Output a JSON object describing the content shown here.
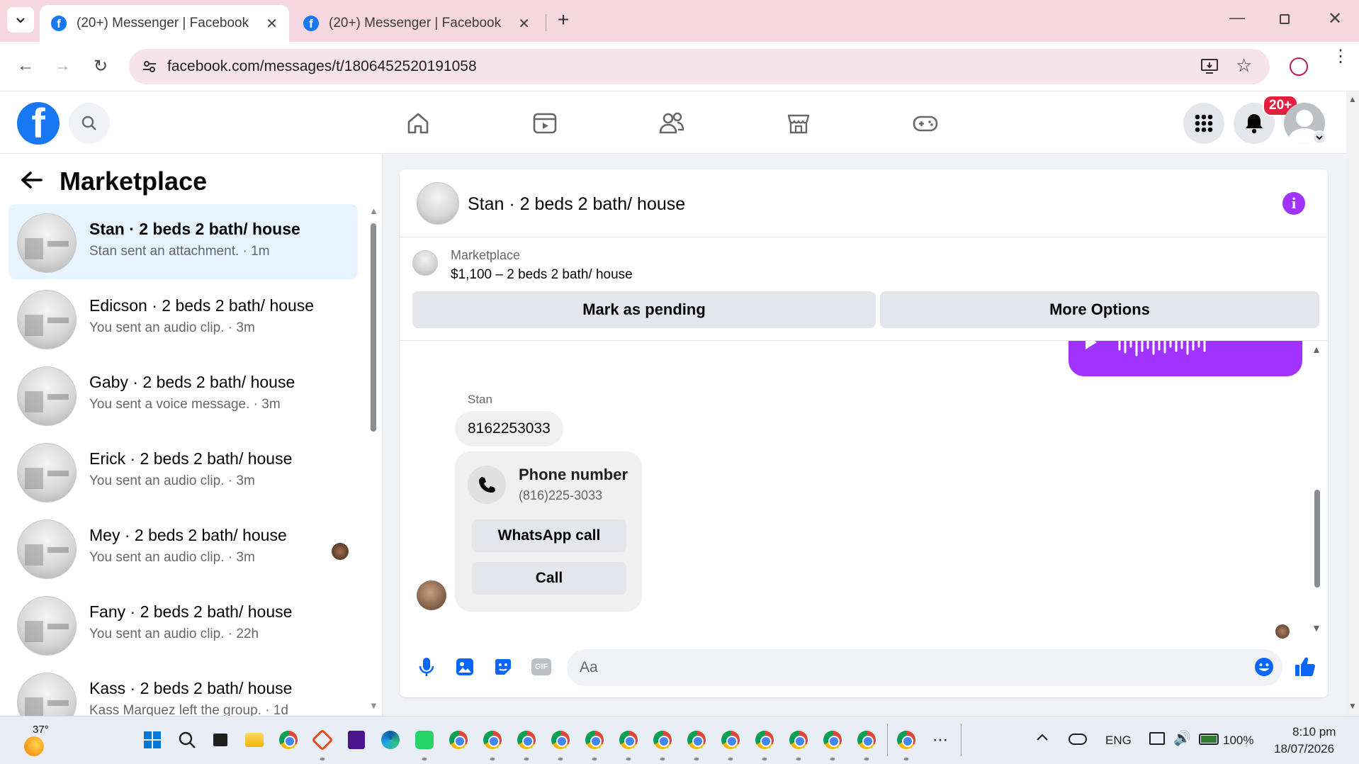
{
  "browser": {
    "tabs": [
      {
        "title": "(20+) Messenger | Facebook",
        "active": true
      },
      {
        "title": "(20+) Messenger | Facebook",
        "active": false
      }
    ],
    "url": "facebook.com/messages/t/1806452520191058"
  },
  "fb_header": {
    "logo": "f",
    "notification_count": "20+"
  },
  "left_panel": {
    "title": "Marketplace",
    "conversations": [
      {
        "name": "Stan · 2 beds 2 bath/ house",
        "sub": "Stan sent an attachment. · 1m",
        "active": true
      },
      {
        "name": "Edicson · 2 beds 2 bath/ house",
        "sub": "You sent an audio clip. · 3m",
        "active": false
      },
      {
        "name": "Gaby · 2 beds 2 bath/ house",
        "sub": "You sent a voice message. · 3m",
        "active": false
      },
      {
        "name": "Erick · 2 beds 2 bath/ house",
        "sub": "You sent an audio clip. · 3m",
        "active": false
      },
      {
        "name": "Mey · 2 beds 2 bath/ house",
        "sub": "You sent an audio clip. · 3m",
        "active": false
      },
      {
        "name": "Fany · 2 beds 2 bath/ house",
        "sub": "You sent an audio clip. · 22h",
        "active": false
      },
      {
        "name": "Kass · 2 beds 2 bath/ house",
        "sub": "Kass Marquez left the group. · 1d",
        "active": false
      }
    ]
  },
  "chat": {
    "title": "Stan · 2 beds 2 bath/ house",
    "marketplace_label": "Marketplace",
    "listing": "$1,100 – 2 beds 2 bath/ house",
    "mark_pending_label": "Mark as pending",
    "more_options_label": "More Options",
    "sender_name": "Stan",
    "message_text": "8162253033",
    "phone_card": {
      "title": "Phone number",
      "value": "(816)225-3033",
      "whatsapp_label": "WhatsApp call",
      "call_label": "Call"
    },
    "input_placeholder": "Aa",
    "accent_color": "#a033ff"
  },
  "taskbar": {
    "weather": "37°",
    "language": "ENG",
    "battery": "100%",
    "time": "8:10 pm",
    "date": "18/07/2026"
  }
}
